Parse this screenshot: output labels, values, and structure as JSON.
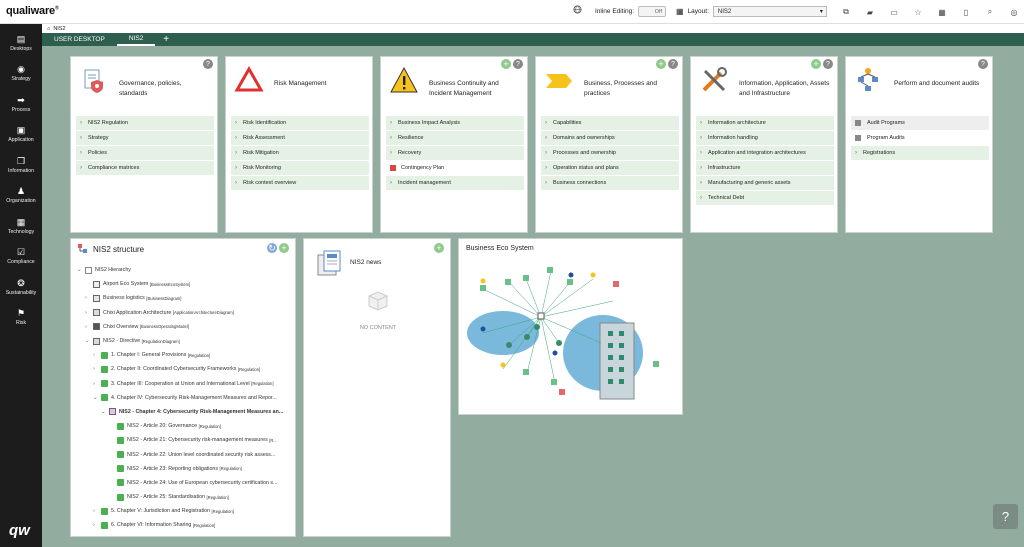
{
  "app": {
    "logo": "qualiware",
    "logo_mark": "®"
  },
  "toolbar": {
    "inline_editing_label": "Inline Editing:",
    "inline_editing_value": "Off",
    "layout_label": "Layout:",
    "layout_value": "NIS2"
  },
  "nav": {
    "items": [
      {
        "label": "Desktops",
        "icon": "desktops-icon",
        "glyph": "▤"
      },
      {
        "label": "Strategy",
        "icon": "target-icon",
        "glyph": "◉"
      },
      {
        "label": "Process",
        "icon": "process-arrow-icon",
        "glyph": "➡"
      },
      {
        "label": "Application",
        "icon": "application-icon",
        "glyph": "▣"
      },
      {
        "label": "Information",
        "icon": "documents-icon",
        "glyph": "❐"
      },
      {
        "label": "Organization",
        "icon": "org-chart-icon",
        "glyph": "♟"
      },
      {
        "label": "Technology",
        "icon": "chip-icon",
        "glyph": "▦"
      },
      {
        "label": "Compliance",
        "icon": "checklist-icon",
        "glyph": "☑"
      },
      {
        "label": "Sustainability",
        "icon": "leaf-icon",
        "glyph": "❂"
      },
      {
        "label": "Risk",
        "icon": "risk-flag-icon",
        "glyph": "⚑"
      }
    ]
  },
  "breadcrumb": {
    "label": "NIS2"
  },
  "tabs": [
    {
      "label": "USER DESKTOP"
    },
    {
      "label": "NIS2"
    }
  ],
  "cards": [
    {
      "title": "Governance, policies, standards",
      "items": [
        "NIS2 Regulation",
        "Strategy",
        "Policies",
        "Compliance matrices"
      ]
    },
    {
      "title": "Risk Management",
      "items": [
        "Risk Identification",
        "Risk Assessment",
        "Risk Mitigation",
        "Risk Monitoring",
        "Risk context overview"
      ]
    },
    {
      "title": "Business Continuity and Incident Management",
      "items": [
        "Business Impact Analysis",
        "Resilience",
        "Recovery",
        "Contingency Plan",
        "Incident management"
      ]
    },
    {
      "title": "Business, Processes and practices",
      "items": [
        "Capabilities",
        "Domains and ownerships",
        "Processes and ownership",
        "Operation status and plans",
        "Business connections"
      ]
    },
    {
      "title": "Information, Application, Assets and Infrastructure",
      "items": [
        "Information architecture",
        "Information handling",
        "Application and integration architectures",
        "Infrastructure",
        "Manufacturing and generic assets",
        "Technical Debt"
      ]
    },
    {
      "title": "Perform and document audits",
      "items": [
        "Audit Programs",
        "Program Audits",
        "Registrations"
      ]
    }
  ],
  "structure": {
    "title": "NIS2 structure",
    "rows": [
      {
        "text": "NIS2 Hierarchy",
        "type": ""
      },
      {
        "text": "Airport Eco System",
        "type": "[BusinessEcoSystem]"
      },
      {
        "text": "Business logistics",
        "type": "[BusinessDiagram]"
      },
      {
        "text": "Chixi Application Architecture",
        "type": "[ApplicationArchitectureDiagram]"
      },
      {
        "text": "Chixi Overview",
        "type": "[BusinessOperatingModel]"
      },
      {
        "text": "NIS2 - Directive",
        "type": "[RegulationDiagram]"
      },
      {
        "text": "1. Chapter I: General Provisions",
        "type": "[Regulation]"
      },
      {
        "text": "2. Chapter II: Coordinated Cybersecurity Frameworks",
        "type": "[Regulation]"
      },
      {
        "text": "3. Chapter III: Cooperation at Union and International Level",
        "type": "[Regulation]"
      },
      {
        "text": "4. Chapter IV: Cybersecurity Risk-Management Measures and Repor...",
        "type": ""
      },
      {
        "text": "NIS2 - Chapter 4: Cybersecurity Risk-Management Measures an...",
        "type": ""
      },
      {
        "text": "NIS2 - Article 20: Governance",
        "type": "[Regulation]"
      },
      {
        "text": "NIS2 - Article 21: Cybersecurity risk-management measures",
        "type": "[R..."
      },
      {
        "text": "NIS2 - Article 22: Union level coordinated security risk assess...",
        "type": ""
      },
      {
        "text": "NIS2 - Article 23: Reporting obligations",
        "type": "[Regulation]"
      },
      {
        "text": "NIS2 - Article 24: Use of European cybersecurity certification s...",
        "type": ""
      },
      {
        "text": "NIS2 - Article 25: Standardisation",
        "type": "[Regulation]"
      },
      {
        "text": "5. Chapter V: Jurisdiction and Registration",
        "type": "[Regulation]"
      },
      {
        "text": "6. Chapter VI: Information Sharing",
        "type": "[Regulation]"
      }
    ]
  },
  "news": {
    "title": "NIS2 news",
    "empty": "NO CONTENT"
  },
  "eco": {
    "title": "Business Eco System"
  },
  "colors": {
    "accent": "#2e5e50",
    "canvas": "#92ada0",
    "menu_bg": "#e6f1e6",
    "nav_bg": "#1c1c1c"
  }
}
